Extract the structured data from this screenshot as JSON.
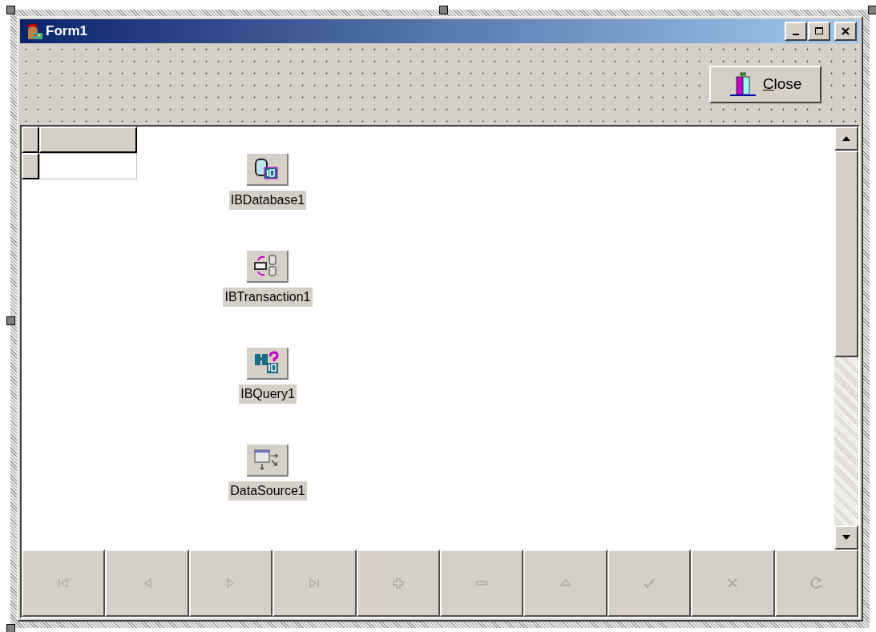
{
  "window": {
    "title": "Form1"
  },
  "title_buttons": [
    {
      "kind": "minimize"
    },
    {
      "kind": "maximize"
    },
    {
      "kind": "close"
    }
  ],
  "close_button": {
    "label": "Close"
  },
  "components": [
    {
      "kind": "database",
      "label": "IBDatabase1"
    },
    {
      "kind": "transaction",
      "label": "IBTransaction1"
    },
    {
      "kind": "query",
      "label": "IBQuery1"
    },
    {
      "kind": "datasource",
      "label": "DataSource1"
    }
  ],
  "navigator": [
    {
      "kind": "first",
      "disabled": true
    },
    {
      "kind": "prior",
      "disabled": true
    },
    {
      "kind": "next",
      "disabled": true
    },
    {
      "kind": "last",
      "disabled": true
    },
    {
      "kind": "insert",
      "disabled": true
    },
    {
      "kind": "delete",
      "disabled": true
    },
    {
      "kind": "edit",
      "disabled": true
    },
    {
      "kind": "post",
      "disabled": true
    },
    {
      "kind": "cancel",
      "disabled": true
    },
    {
      "kind": "refresh",
      "disabled": true
    }
  ]
}
